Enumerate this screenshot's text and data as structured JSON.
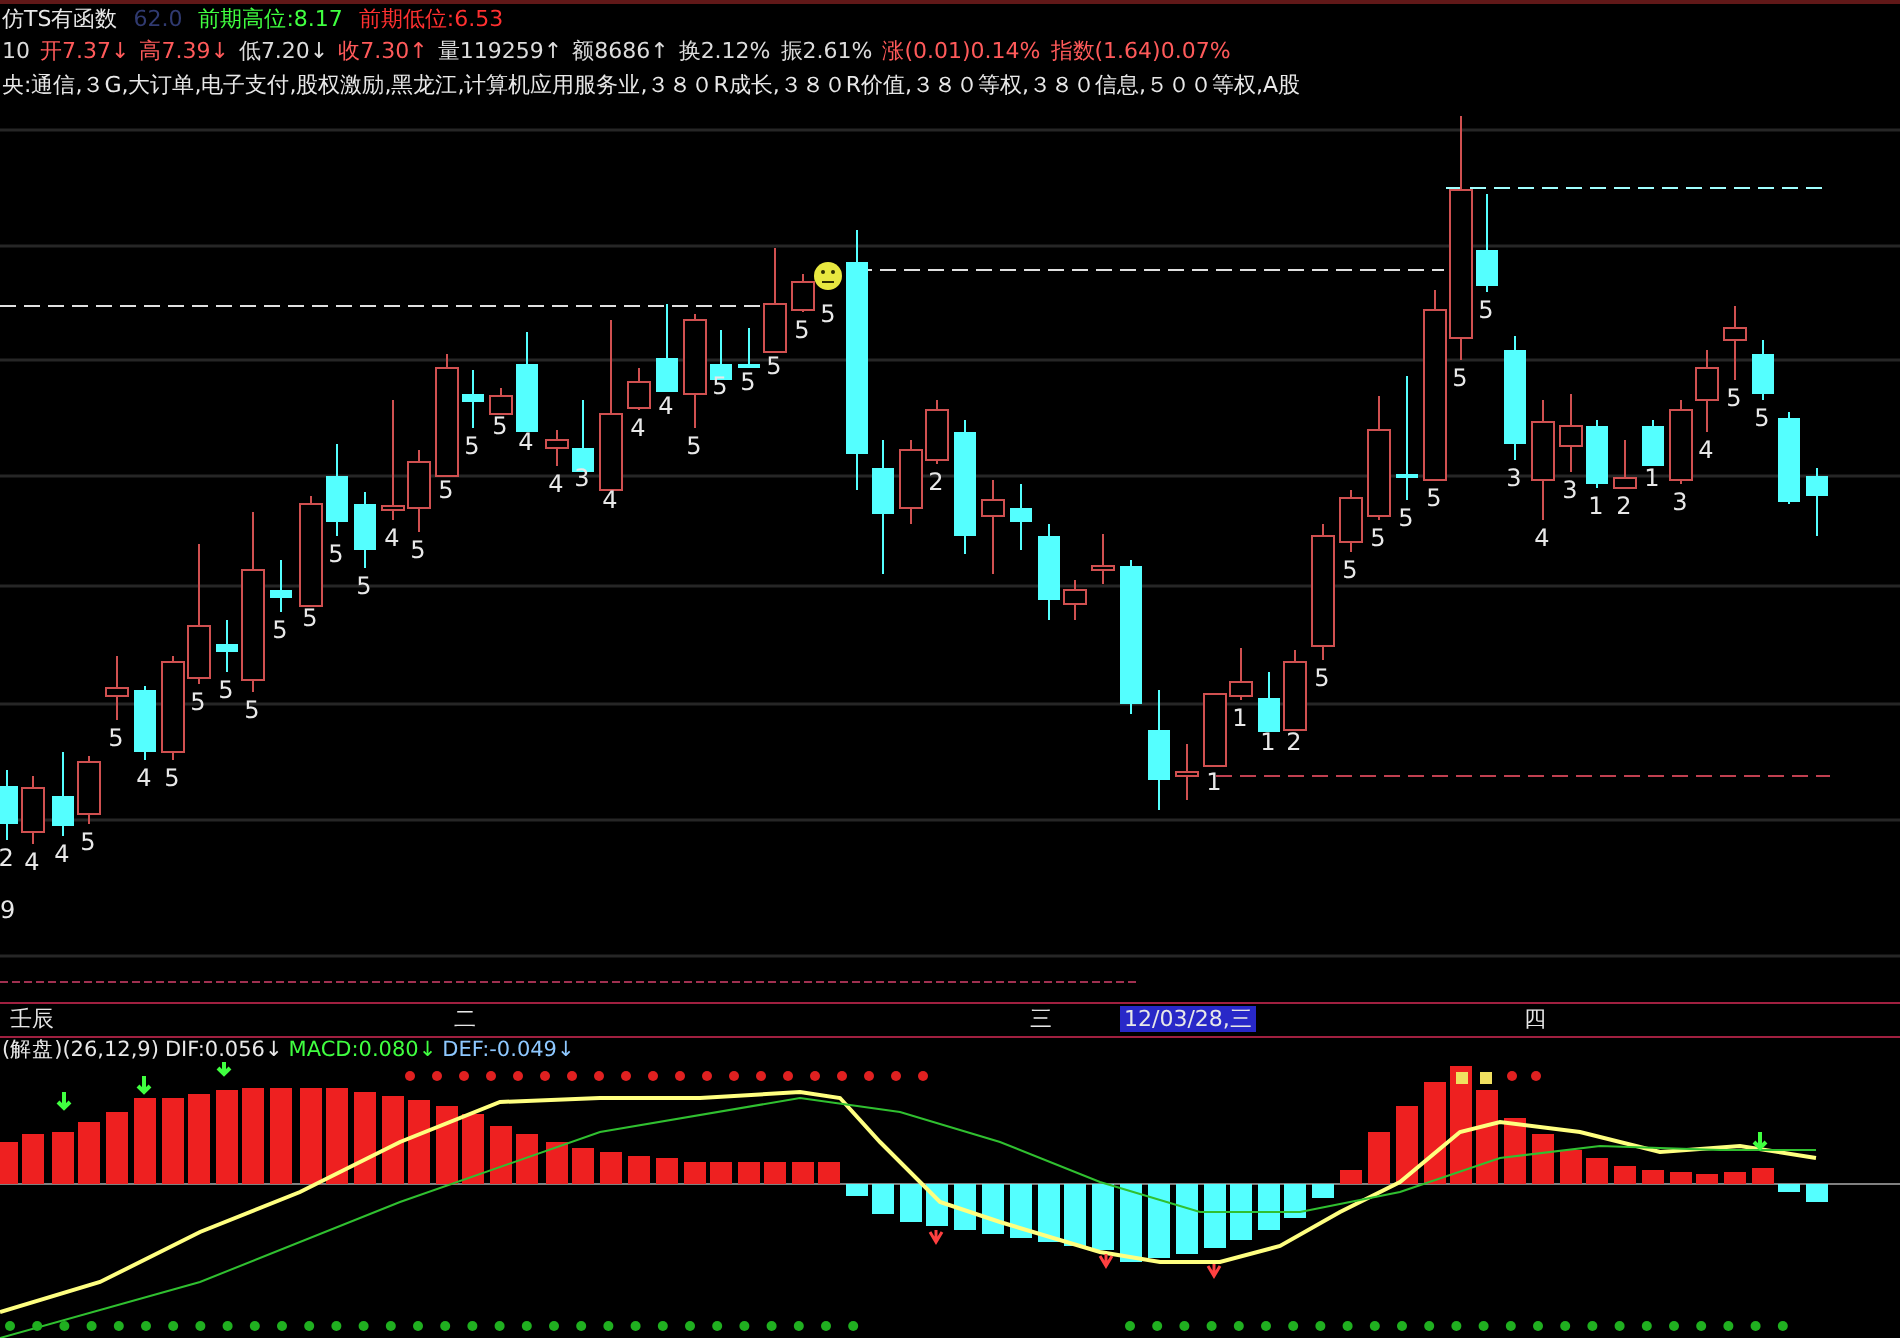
{
  "header": {
    "title": "仿TS有函数",
    "code": "62.0",
    "prev_high": "前期高位:8.17",
    "prev_low": "前期低位:6.53"
  },
  "quote": [
    {
      "text": "10",
      "kind": "neutral"
    },
    {
      "text": "开7.37↓",
      "kind": "rise"
    },
    {
      "text": "高7.39↓",
      "kind": "rise"
    },
    {
      "text": "低7.20↓",
      "kind": "neutral"
    },
    {
      "text": "收7.30↑",
      "kind": "rise"
    },
    {
      "text": "量119259↑",
      "kind": "neutral"
    },
    {
      "text": "额8686↑",
      "kind": "neutral"
    },
    {
      "text": "换2.12%",
      "kind": "neutral"
    },
    {
      "text": "振2.61%",
      "kind": "neutral"
    },
    {
      "text": "涨(0.01)0.14%",
      "kind": "rise"
    },
    {
      "text": "指数(1.64)0.07%",
      "kind": "rise"
    }
  ],
  "sectors": "央:通信,３G,大订单,电子支付,股权激励,黑龙江,计算机应用服务业,３８０R成长,３８０R价值,３８０等权,３８０信息,５００等权,A股",
  "price_chart": {
    "axis_fragment": "9",
    "candles": [
      {
        "kind": "down",
        "label": "2"
      },
      {
        "kind": "up",
        "label": "4"
      },
      {
        "kind": "down",
        "label": "4"
      },
      {
        "kind": "up",
        "label": "5"
      },
      {
        "kind": "up",
        "label": "5"
      },
      {
        "kind": "down",
        "label": "4"
      },
      {
        "kind": "up",
        "label": "5"
      },
      {
        "kind": "up",
        "label": "5"
      },
      {
        "kind": "down",
        "label": "5"
      },
      {
        "kind": "up",
        "label": "5"
      },
      {
        "kind": "down",
        "label": "5"
      },
      {
        "kind": "up",
        "label": "5"
      },
      {
        "kind": "down",
        "label": "5"
      },
      {
        "kind": "down",
        "label": "5"
      },
      {
        "kind": "up",
        "label": "4"
      },
      {
        "kind": "up",
        "label": "5"
      },
      {
        "kind": "up",
        "label": "5"
      },
      {
        "kind": "down",
        "label": "5"
      },
      {
        "kind": "up",
        "label": "5"
      },
      {
        "kind": "down",
        "label": "4"
      },
      {
        "kind": "up",
        "label": "4"
      },
      {
        "kind": "down",
        "label": "3"
      },
      {
        "kind": "up",
        "label": "4"
      },
      {
        "kind": "up",
        "label": "4"
      },
      {
        "kind": "down",
        "label": "4"
      },
      {
        "kind": "up",
        "label": "5"
      },
      {
        "kind": "down",
        "label": "5"
      },
      {
        "kind": "down",
        "label": "5"
      },
      {
        "kind": "up",
        "label": "5"
      },
      {
        "kind": "up",
        "label": "5"
      },
      {
        "kind": "smiley",
        "label": "5"
      },
      {
        "kind": "down"
      },
      {
        "kind": "down"
      },
      {
        "kind": "up"
      },
      {
        "kind": "up",
        "label": "2"
      },
      {
        "kind": "down"
      },
      {
        "kind": "up"
      },
      {
        "kind": "down"
      },
      {
        "kind": "down"
      },
      {
        "kind": "up"
      },
      {
        "kind": "up"
      },
      {
        "kind": "down"
      },
      {
        "kind": "down"
      },
      {
        "kind": "up"
      },
      {
        "kind": "up",
        "label": "1"
      },
      {
        "kind": "up",
        "label": "1"
      },
      {
        "kind": "down",
        "label": "1"
      },
      {
        "kind": "up",
        "label": "2"
      },
      {
        "kind": "up",
        "label": "5"
      },
      {
        "kind": "up",
        "label": "5"
      },
      {
        "kind": "up",
        "label": "5"
      },
      {
        "kind": "down",
        "label": "5"
      },
      {
        "kind": "up",
        "label": "5"
      },
      {
        "kind": "up",
        "label": "5"
      },
      {
        "kind": "down",
        "label": "5"
      },
      {
        "kind": "down",
        "label": "3"
      },
      {
        "kind": "up",
        "label": "4"
      },
      {
        "kind": "up",
        "label": "3"
      },
      {
        "kind": "down",
        "label": "1"
      },
      {
        "kind": "up",
        "label": "2"
      },
      {
        "kind": "down",
        "label": "1"
      },
      {
        "kind": "up",
        "label": "3"
      },
      {
        "kind": "up",
        "label": "4"
      },
      {
        "kind": "up",
        "label": "5"
      },
      {
        "kind": "down",
        "label": "5"
      },
      {
        "kind": "down"
      },
      {
        "kind": "down"
      }
    ]
  },
  "date_axis": [
    {
      "text": "壬辰",
      "selected": false
    },
    {
      "text": "二",
      "selected": false
    },
    {
      "text": "三",
      "selected": false
    },
    {
      "text": "12/03/28,三",
      "selected": true
    },
    {
      "text": "四",
      "selected": false
    }
  ],
  "macd": {
    "params": "(解盘)(26,12,9)",
    "readings": [
      {
        "text": "DIF:0.056↓",
        "kind": "dif"
      },
      {
        "text": "MACD:0.080↓",
        "kind": "macd"
      },
      {
        "text": "DEF:-0.049↓",
        "kind": "dea"
      }
    ]
  }
}
